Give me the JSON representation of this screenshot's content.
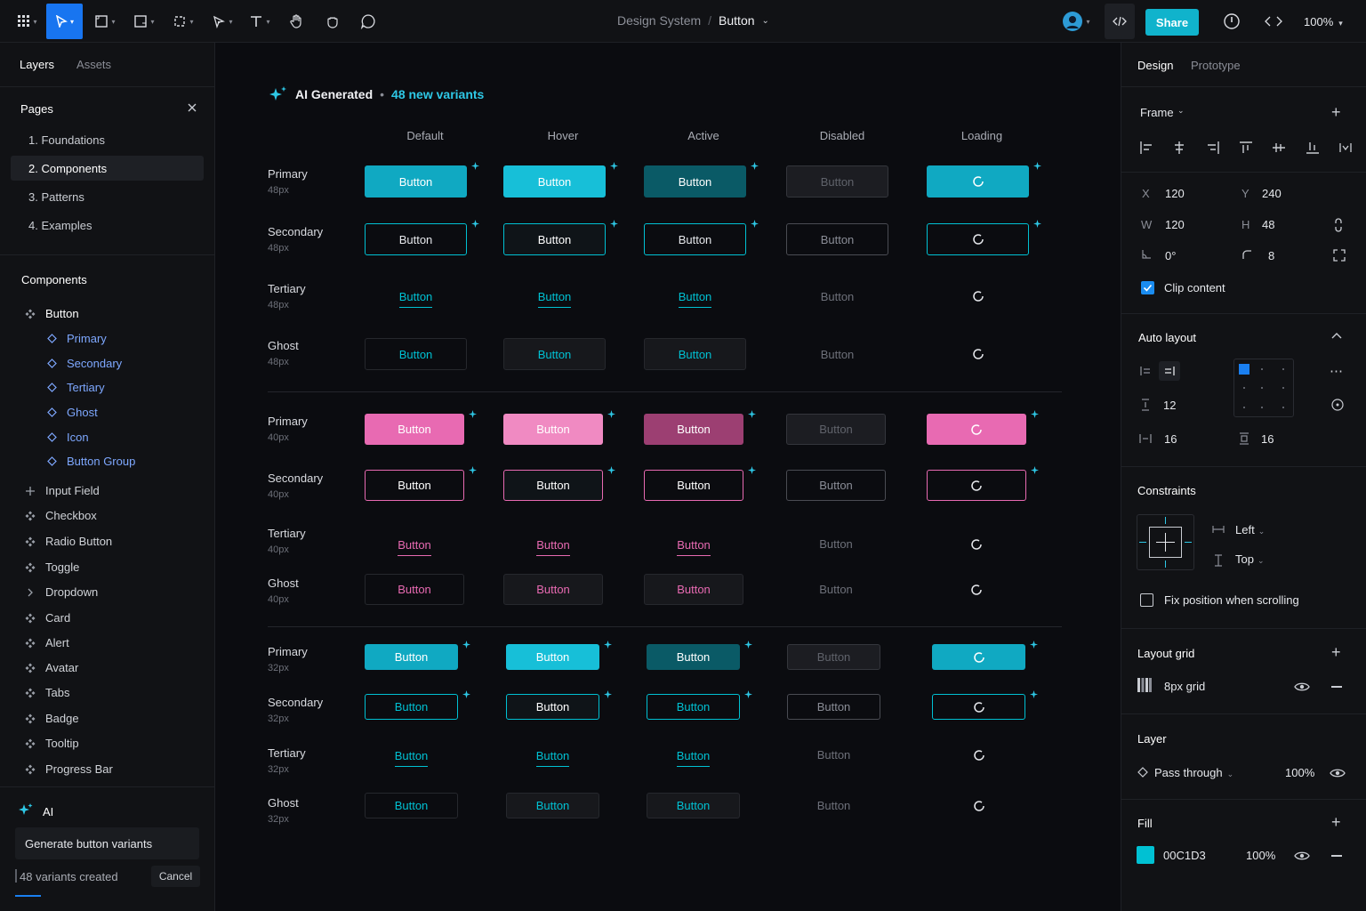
{
  "toolbar": {
    "breadcrumb_parent": "Design System",
    "breadcrumb_sep": "/",
    "breadcrumb_current": "Button",
    "share_label": "Share",
    "zoom": "100%"
  },
  "left_panel": {
    "tabs": [
      "Layers",
      "Assets"
    ],
    "pages_title": "Pages",
    "pages": [
      "1.  Foundations",
      "2.  Components",
      "3.  Patterns",
      "4.  Examples"
    ],
    "components_title": "Components",
    "tree": [
      {
        "label": "Button",
        "icon": "component-icon"
      },
      {
        "label": "Primary",
        "icon": "variant-icon"
      },
      {
        "label": "Secondary",
        "icon": "variant-icon"
      },
      {
        "label": "Tertiary",
        "icon": "variant-icon"
      },
      {
        "label": "Ghost",
        "icon": "variant-icon"
      },
      {
        "label": "Icon",
        "icon": "variant-icon"
      },
      {
        "label": "Button Group",
        "icon": "variant-icon"
      },
      {
        "label": "Input Field",
        "icon": "plus-icon"
      },
      {
        "label": "Checkbox",
        "icon": "component-icon"
      },
      {
        "label": "Radio Button",
        "icon": "component-icon"
      },
      {
        "label": "Toggle",
        "icon": "component-icon"
      },
      {
        "label": "Dropdown",
        "icon": "chevron-right-icon"
      },
      {
        "label": "Card",
        "icon": "component-icon"
      },
      {
        "label": "Alert",
        "icon": "component-icon"
      },
      {
        "label": "Avatar",
        "icon": "component-icon"
      },
      {
        "label": "Tabs",
        "icon": "component-icon"
      },
      {
        "label": "Badge",
        "icon": "component-icon"
      },
      {
        "label": "Tooltip",
        "icon": "component-icon"
      },
      {
        "label": "Progress Bar",
        "icon": "component-icon"
      }
    ],
    "ai": {
      "title": "AI",
      "prompt": "Generate button variants",
      "status": "48 variants created",
      "cancel": "Cancel"
    }
  },
  "canvas": {
    "header_label": "AI Generated",
    "header_dot": "•",
    "header_count": "48 new variants",
    "columns": [
      "Default",
      "Hover",
      "Active",
      "Disabled",
      "Loading"
    ],
    "button_label": "Button",
    "groups": [
      {
        "size": "48px",
        "rows": [
          "Primary",
          "Secondary",
          "Tertiary",
          "Ghost"
        ]
      },
      {
        "size": "40px",
        "rows": [
          "Primary",
          "Secondary",
          "Tertiary",
          "Ghost"
        ]
      },
      {
        "size": "32px",
        "rows": [
          "Primary",
          "Secondary",
          "Tertiary",
          "Ghost"
        ]
      }
    ],
    "colors": {
      "cyan": "#00C1D3",
      "pink": "#E86AB2"
    }
  },
  "right_panel": {
    "tabs": [
      "Design",
      "Prototype"
    ],
    "frame_label": "Frame",
    "x_label": "X",
    "x_val": "120",
    "y_label": "Y",
    "y_val": "240",
    "w_label": "W",
    "w_val": "120",
    "h_label": "H",
    "h_val": "48",
    "rotation": "0°",
    "radius": "8",
    "clip_content": "Clip content",
    "auto_layout": "Auto layout",
    "gap": "12",
    "pad_h": "16",
    "pad_v": "16",
    "constraints": "Constraints",
    "constraint_h": "Left",
    "constraint_v": "Top",
    "fix_position": "Fix position when scrolling",
    "layout_grid": "Layout grid",
    "grid_name": "8px grid",
    "layer": "Layer",
    "blend": "Pass through",
    "opacity": "100%",
    "fill": "Fill",
    "fill_hex": "00C1D3",
    "fill_opacity": "100%",
    "fill_color": "#00C1D3"
  }
}
